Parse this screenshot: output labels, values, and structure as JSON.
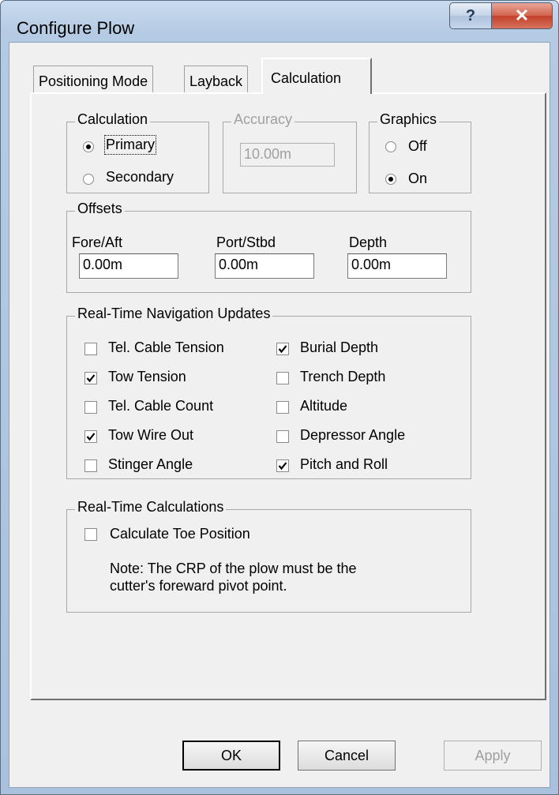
{
  "window": {
    "title": "Configure Plow",
    "help_glyph": "?",
    "close_glyph": "✕"
  },
  "tabs": [
    {
      "label": "Positioning Mode",
      "active": false
    },
    {
      "label": "Layback",
      "active": false
    },
    {
      "label": "Calculation",
      "active": true
    }
  ],
  "calculation_group": {
    "legend": "Calculation",
    "options": [
      {
        "label": "Primary",
        "selected": true
      },
      {
        "label": "Secondary",
        "selected": false
      }
    ]
  },
  "accuracy_group": {
    "legend": "Accuracy",
    "value": "10.00m",
    "enabled": false
  },
  "graphics_group": {
    "legend": "Graphics",
    "options": [
      {
        "label": "Off",
        "selected": false
      },
      {
        "label": "On",
        "selected": true
      }
    ]
  },
  "offsets_group": {
    "legend": "Offsets",
    "fields": [
      {
        "label": "Fore/Aft",
        "value": "0.00m"
      },
      {
        "label": "Port/Stbd",
        "value": "0.00m"
      },
      {
        "label": "Depth",
        "value": "0.00m"
      }
    ]
  },
  "nav_updates_group": {
    "legend": "Real-Time Navigation Updates",
    "items": [
      {
        "label": "Tel. Cable Tension",
        "checked": false
      },
      {
        "label": "Burial Depth",
        "checked": true
      },
      {
        "label": "Tow Tension",
        "checked": true
      },
      {
        "label": "Trench Depth",
        "checked": false
      },
      {
        "label": "Tel. Cable Count",
        "checked": false
      },
      {
        "label": "Altitude",
        "checked": false
      },
      {
        "label": "Tow Wire Out",
        "checked": true
      },
      {
        "label": "Depressor Angle",
        "checked": false
      },
      {
        "label": "Stinger Angle",
        "checked": false
      },
      {
        "label": "Pitch and Roll",
        "checked": true
      }
    ]
  },
  "calculations_group": {
    "legend": "Real-Time Calculations",
    "toe_label": "Calculate Toe Position",
    "toe_checked": false,
    "note_line1": "Note: The CRP of the plow must be the",
    "note_line2": "cutter's foreward pivot point."
  },
  "buttons": {
    "ok": "OK",
    "cancel": "Cancel",
    "apply": "Apply"
  }
}
